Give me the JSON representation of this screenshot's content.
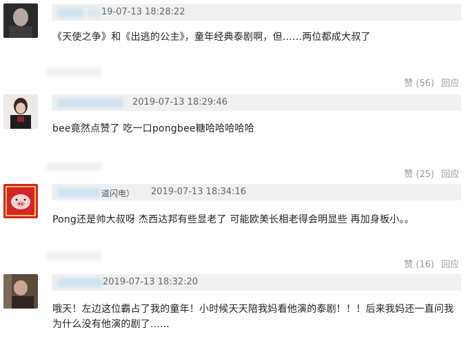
{
  "comments": [
    {
      "suffix": "",
      "time": "19-07-13 18:28:22",
      "text": "《天使之争》和《出逃的公主》，童年经典泰剧啊，但……两位都成大叔了",
      "like_label": "赞 (56)",
      "reply_label": "回应"
    },
    {
      "suffix": "",
      "time": "2019-07-13 18:29:46",
      "text": "bee竟然点赞了 吃一口pongbee糖哈哈哈哈哈",
      "like_label": "赞 (25)",
      "reply_label": "回应"
    },
    {
      "suffix": "道闪电）",
      "time": "2019-07-13 18:34:16",
      "text": "Pong还是帅大叔呀 杰西达邦有些显老了 可能欧美长相老得会明显些 再加身板小。。",
      "like_label": "赞 (16)",
      "reply_label": "回应"
    },
    {
      "suffix": "",
      "time": "2019-07-13 18:32:20",
      "text": "哦天！左边这位霸占了我的童年！小时候天天陪我妈看他演的泰剧！！！后来我妈还一直问我为什么没有他演的剧了......",
      "like_label": "",
      "reply_label": ""
    }
  ]
}
